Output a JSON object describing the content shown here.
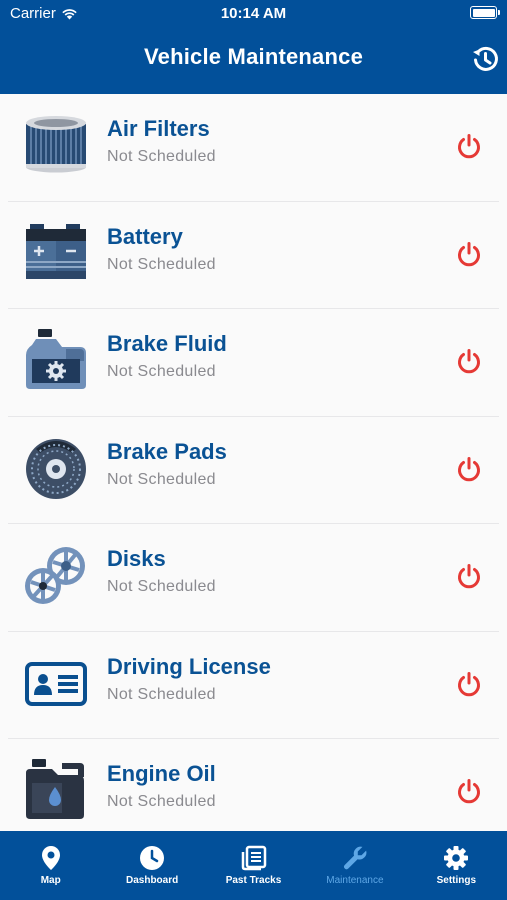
{
  "status_bar": {
    "carrier": "Carrier",
    "time": "10:14 AM"
  },
  "header": {
    "title": "Vehicle Maintenance"
  },
  "colors": {
    "brand": "#02509a",
    "item_title": "#0a5294",
    "toggle": "#e53935",
    "active_tab": "#5ea7e6"
  },
  "items": [
    {
      "name": "Air Filters",
      "status": "Not Scheduled",
      "icon": "air-filter-icon"
    },
    {
      "name": "Battery",
      "status": "Not Scheduled",
      "icon": "battery-icon"
    },
    {
      "name": "Brake Fluid",
      "status": "Not Scheduled",
      "icon": "brake-fluid-icon"
    },
    {
      "name": "Brake Pads",
      "status": "Not Scheduled",
      "icon": "brake-pads-icon"
    },
    {
      "name": "Disks",
      "status": "Not Scheduled",
      "icon": "disks-icon"
    },
    {
      "name": "Driving License",
      "status": "Not Scheduled",
      "icon": "driving-license-icon"
    },
    {
      "name": "Engine Oil",
      "status": "Not Scheduled",
      "icon": "engine-oil-icon"
    }
  ],
  "tabs": [
    {
      "label": "Map",
      "icon": "map-pin-icon"
    },
    {
      "label": "Dashboard",
      "icon": "clock-icon"
    },
    {
      "label": "Past Tracks",
      "icon": "tracks-icon"
    },
    {
      "label": "Maintenance",
      "icon": "wrench-icon",
      "active": true
    },
    {
      "label": "Settings",
      "icon": "gear-icon"
    }
  ]
}
